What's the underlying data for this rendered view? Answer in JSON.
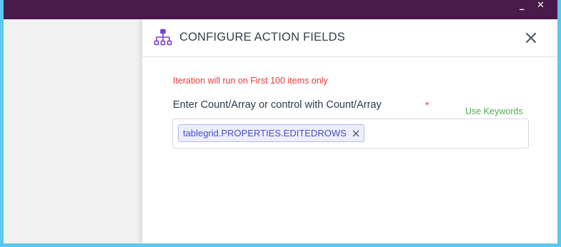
{
  "window": {
    "minimize_label": "_",
    "close_label": "✕"
  },
  "panel": {
    "title": "CONFIGURE ACTION FIELDS",
    "header_icon": "hierarchy-icon",
    "close_icon": "close-icon",
    "warning": "Iteration will run on First 100 items only",
    "field_label": "Enter Count/Array or control with Count/Array",
    "required_marker": "*",
    "keywords_link": "Use Keywords",
    "tags": [
      {
        "label": "tablegrid.PROPERTIES.EDITEDROWS",
        "remove_icon": "remove-tag-icon"
      }
    ]
  },
  "colors": {
    "titlebar": "#4a1a4a",
    "frame": "#5bc8ee",
    "accent_icon": "#7a3fd4",
    "warning": "#e63b3b",
    "keywords": "#4caf50",
    "tag_text": "#4a4fc4"
  }
}
